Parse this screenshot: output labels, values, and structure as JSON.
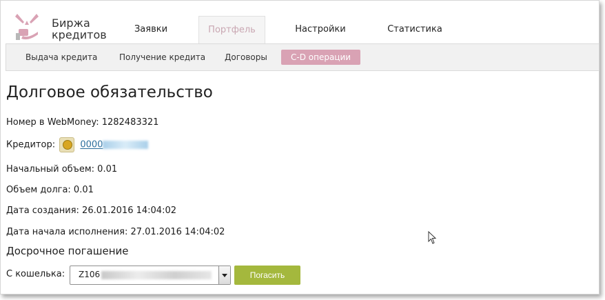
{
  "brand": {
    "line1": "Биржа",
    "line2": "кредитов"
  },
  "tabs": [
    {
      "label": "Заявки"
    },
    {
      "label": "Портфель"
    },
    {
      "label": "Настройки"
    },
    {
      "label": "Статистика"
    }
  ],
  "subnav": [
    {
      "label": "Выдача кредита"
    },
    {
      "label": "Получение кредита"
    },
    {
      "label": "Договоры"
    },
    {
      "label": "C-D операции"
    }
  ],
  "page": {
    "title": "Долговое обязательство"
  },
  "fields": {
    "wm_number": "Номер в WebMoney: 1282483321",
    "creditor_label": "Кредитор:",
    "creditor_link": "0000",
    "initial_volume": "Начальный объем: 0.01",
    "debt_volume": "Объем долга: 0.01",
    "created": "Дата создания: 26.01.2016 14:04:02",
    "start_exec": "Дата начала исполнения: 27.01.2016 14:04:02"
  },
  "early": {
    "heading": "Досрочное погашение",
    "wallet_label": "С кошелька:",
    "wallet_value": "Z106",
    "pay_button": "Погасить"
  },
  "colors": {
    "accent_pink": "#d9a2b4",
    "button_green": "#a4b83d",
    "link_blue": "#2b6e9c"
  }
}
